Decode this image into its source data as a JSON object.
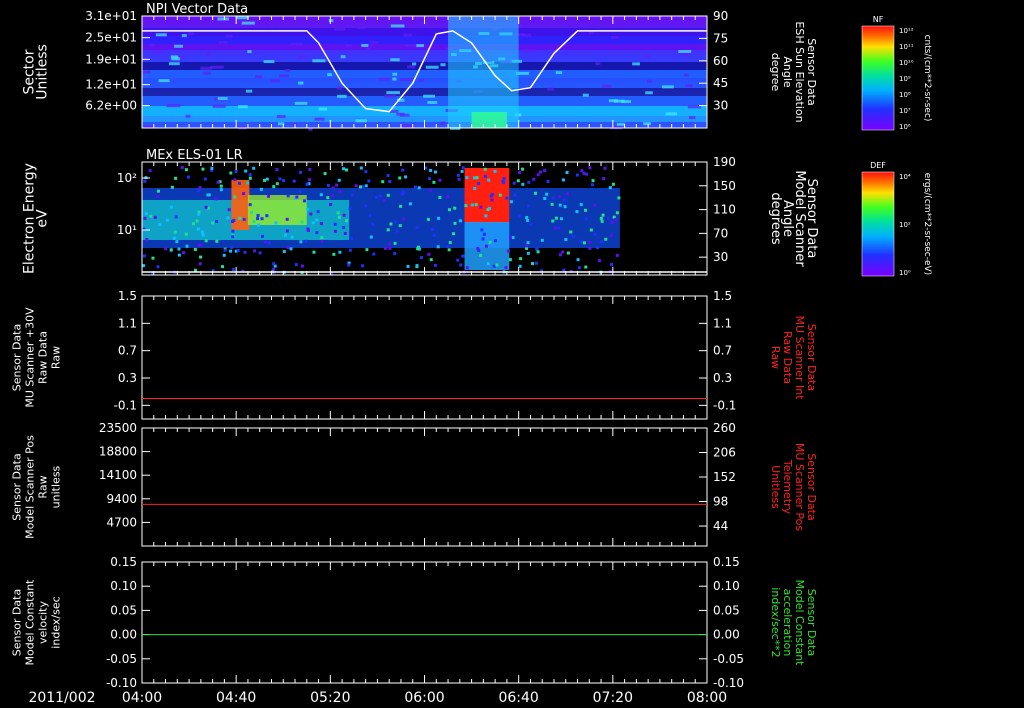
{
  "date_label": "2011/002",
  "time_ticks": [
    "04:00",
    "04:40",
    "05:20",
    "06:00",
    "06:40",
    "07:20",
    "08:00"
  ],
  "colorbars": [
    {
      "tag": "NF",
      "unit": "cnts/(cm**2-sr-sec)",
      "ticks": [
        "10¹²",
        "10¹¹",
        "10¹⁰",
        "10⁹",
        "10⁸",
        "10⁷",
        "10⁶"
      ]
    },
    {
      "tag": "DEF",
      "unit": "ergs/(cm**2-sr-sec-eV)",
      "ticks": [
        "10⁴",
        "10²",
        "10⁰"
      ]
    }
  ],
  "chart_data": [
    {
      "type": "heatmap",
      "title": "NPI Vector Data",
      "ylabel": [
        "Sector",
        "Unitless"
      ],
      "yticks": [
        "3.1e+01",
        "2.5e+01",
        "1.9e+01",
        "1.2e+01",
        "6.2e+00"
      ],
      "ylim": [
        0,
        31
      ],
      "y2label": [
        "Sensor Data",
        "ESH Sun Elevation",
        "Angle",
        "degree"
      ],
      "y2ticks": [
        "90",
        "75",
        "60",
        "45",
        "30"
      ],
      "y2lim": [
        15,
        90
      ],
      "xlim": [
        "04:00",
        "08:00"
      ],
      "overlay_series": {
        "name": "ESH Sun Elevation Angle",
        "color": "#ffffff",
        "x": [
          "04:00",
          "05:10",
          "05:15",
          "05:25",
          "05:35",
          "05:45",
          "05:55",
          "06:05",
          "06:12",
          "06:20",
          "06:30",
          "06:37",
          "06:45",
          "06:55",
          "07:05",
          "08:00"
        ],
        "y": [
          80,
          80,
          72,
          45,
          28,
          26,
          45,
          78,
          80,
          72,
          50,
          40,
          42,
          65,
          80,
          80
        ]
      }
    },
    {
      "type": "heatmap",
      "title": "MEx ELS-01 LR",
      "ylabel": [
        "Electron Energy",
        "eV"
      ],
      "yticks": [
        "10²",
        "10¹"
      ],
      "ylog": true,
      "y2label": [
        "Sensor Data",
        "Model Scanner",
        "Angle",
        "degrees"
      ],
      "y2ticks": [
        "190",
        "150",
        "110",
        "70",
        "30"
      ],
      "y2lim": [
        0,
        190
      ],
      "xlim": [
        "04:00",
        "08:00"
      ],
      "data_end": "07:23",
      "overlay_series": {
        "name": "Model Scanner Angle",
        "color": "#ffffff",
        "x": [
          "04:00",
          "08:00"
        ],
        "y": [
          5,
          5
        ]
      }
    },
    {
      "type": "line",
      "ylabel": [
        "Sensor Data",
        "MU Scanner +30V",
        "Raw Data",
        "Raw"
      ],
      "yticks": [
        "1.5",
        "1.1",
        "0.7",
        "0.3",
        "-0.1"
      ],
      "ylim": [
        -0.3,
        1.5
      ],
      "y2label": [
        "Sensor Data",
        "MU Scanner Int",
        "Raw Data",
        "Raw"
      ],
      "y2ticks": [
        "1.5",
        "1.1",
        "0.7",
        "0.3",
        "-0.1"
      ],
      "y2lim": [
        -0.3,
        1.5
      ],
      "y2label_color": "#ff2020",
      "xlim": [
        "04:00",
        "08:00"
      ],
      "series": [
        {
          "color": "#ff2020",
          "x": [
            "04:00",
            "08:00"
          ],
          "y": [
            0.0,
            0.0
          ]
        }
      ]
    },
    {
      "type": "line",
      "ylabel": [
        "Sensor Data",
        "Model Scanner Pos",
        "Raw",
        "unitless"
      ],
      "yticks": [
        "23500",
        "18800",
        "14100",
        "9400",
        "4700"
      ],
      "ylim": [
        0,
        23500
      ],
      "y2label": [
        "Sensor Data",
        "MU Scanner Pos",
        "Telemetry",
        "Unitless"
      ],
      "y2ticks": [
        "260",
        "206",
        "152",
        "98",
        "44"
      ],
      "y2lim": [
        0,
        260
      ],
      "y2label_color": "#ff2020",
      "xlim": [
        "04:00",
        "08:00"
      ],
      "series": [
        {
          "color": "#ff2020",
          "x": [
            "04:00",
            "08:00"
          ],
          "y": [
            8300,
            8300
          ]
        }
      ]
    },
    {
      "type": "line",
      "ylabel": [
        "Sensor Data",
        "Model Constant",
        "velocity",
        "index/sec"
      ],
      "yticks": [
        "0.15",
        "0.10",
        "0.05",
        "0.00",
        "-0.05",
        "-0.10"
      ],
      "ylim": [
        -0.1,
        0.15
      ],
      "y2label": [
        "Sensor Data",
        "Model Constant",
        "acceleration",
        "index/sec**2"
      ],
      "y2ticks": [
        "0.15",
        "0.10",
        "0.05",
        "0.00",
        "-0.05",
        "-0.10"
      ],
      "y2lim": [
        -0.1,
        0.15
      ],
      "y2label_color": "#30e030",
      "xlim": [
        "04:00",
        "08:00"
      ],
      "series": [
        {
          "color": "#30e030",
          "x": [
            "04:00",
            "08:00"
          ],
          "y": [
            0.0,
            0.0
          ]
        }
      ]
    }
  ]
}
